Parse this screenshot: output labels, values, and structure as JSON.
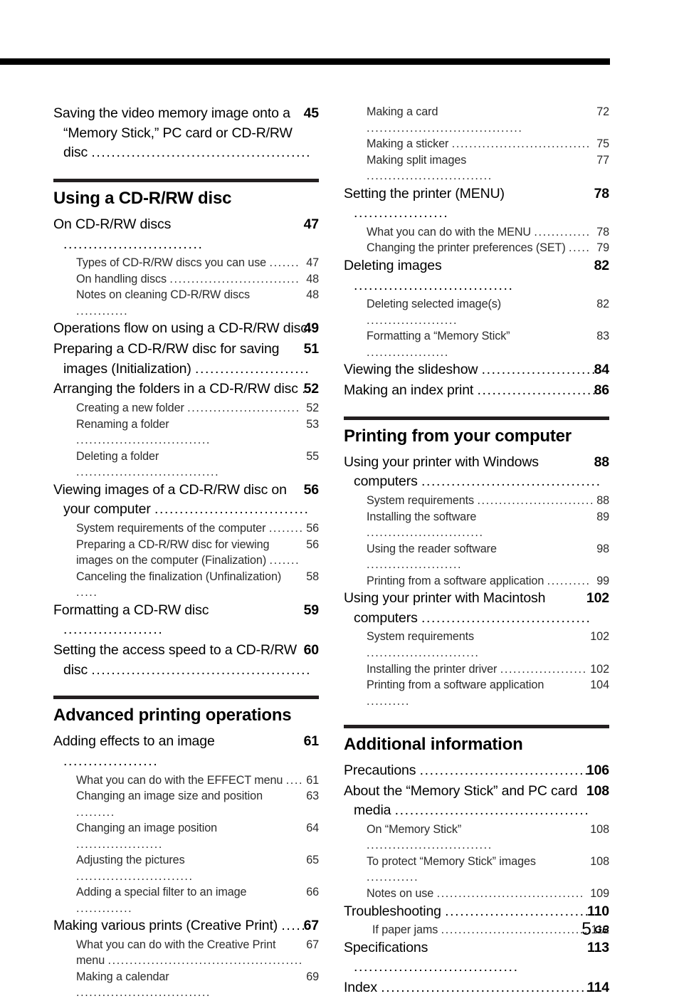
{
  "page": {
    "folio_number": "5",
    "folio_suffix": "GB"
  },
  "columns": {
    "left": [
      {
        "type": "orphan_entries",
        "entries": [
          {
            "level": "major",
            "text": "Saving the video memory image onto a “Memory Stick,” PC card or CD-R/RW disc",
            "page": "45"
          }
        ]
      },
      {
        "type": "section",
        "title": "Using a CD-R/RW disc",
        "entries": [
          {
            "level": "major",
            "text": "On CD-R/RW discs",
            "page": "47"
          },
          {
            "level": "sub",
            "text": "Types of CD-R/RW discs you can use",
            "page": "47"
          },
          {
            "level": "sub",
            "text": "On handling discs",
            "page": "48"
          },
          {
            "level": "sub",
            "text": "Notes on cleaning CD-R/RW discs",
            "page": "48"
          },
          {
            "level": "major",
            "text": "Operations flow on using a CD-R/RW disc",
            "page": "49"
          },
          {
            "level": "major",
            "text": "Preparing a CD-R/RW disc for saving images (Initialization)",
            "page": "51"
          },
          {
            "level": "major",
            "text": "Arranging the folders in a CD-R/RW disc",
            "page": "52"
          },
          {
            "level": "sub",
            "text": "Creating a new folder",
            "page": "52"
          },
          {
            "level": "sub",
            "text": "Renaming a folder",
            "page": "53"
          },
          {
            "level": "sub",
            "text": "Deleting a folder",
            "page": "55"
          },
          {
            "level": "major",
            "text": "Viewing images of a CD-R/RW disc on your computer",
            "page": "56"
          },
          {
            "level": "sub",
            "text": "System requirements of the computer",
            "page": "56"
          },
          {
            "level": "sub",
            "text": "Preparing a CD-R/RW disc for viewing images on the computer (Finalization)",
            "page": "56"
          },
          {
            "level": "sub",
            "text": "Canceling the finalization (Unfinalization)",
            "page": "58"
          },
          {
            "level": "major",
            "text": "Formatting a CD-RW disc",
            "page": "59"
          },
          {
            "level": "major",
            "text": "Setting the access speed to a CD-R/RW disc",
            "page": "60"
          }
        ]
      },
      {
        "type": "section",
        "title": "Advanced printing operations",
        "entries": [
          {
            "level": "major",
            "text": "Adding effects to an image",
            "page": "61"
          },
          {
            "level": "sub",
            "text": "What you can do with the EFFECT menu",
            "page": "61"
          },
          {
            "level": "sub",
            "text": "Changing an image size and position",
            "page": "63"
          },
          {
            "level": "sub",
            "text": "Changing an image position",
            "page": "64"
          },
          {
            "level": "sub",
            "text": "Adjusting the pictures",
            "page": "65"
          },
          {
            "level": "sub",
            "text": "Adding a special filter to an image",
            "page": "66"
          },
          {
            "level": "major",
            "text": "Making various prints (Creative Print)",
            "page": "67"
          },
          {
            "level": "sub",
            "text": "What you can do with the Creative Print menu",
            "page": "67"
          },
          {
            "level": "sub",
            "text": "Making a calendar",
            "page": "69"
          }
        ]
      }
    ],
    "right": [
      {
        "type": "orphan_entries",
        "entries": [
          {
            "level": "sub",
            "text": "Making a card",
            "page": "72"
          },
          {
            "level": "sub",
            "text": "Making a sticker",
            "page": "75"
          },
          {
            "level": "sub",
            "text": "Making split images",
            "page": "77"
          },
          {
            "level": "major",
            "text": "Setting the printer (MENU)",
            "page": "78"
          },
          {
            "level": "sub",
            "text": "What you can do with the MENU",
            "page": "78"
          },
          {
            "level": "sub",
            "text": "Changing the printer preferences (SET)",
            "page": "79"
          },
          {
            "level": "major",
            "text": "Deleting images",
            "page": "82"
          },
          {
            "level": "sub",
            "text": "Deleting selected image(s)",
            "page": "82"
          },
          {
            "level": "sub",
            "text": "Formatting a “Memory Stick”",
            "page": "83"
          },
          {
            "level": "major",
            "text": "Viewing the slideshow",
            "page": "84"
          },
          {
            "level": "major",
            "text": "Making an index print",
            "page": "86"
          }
        ]
      },
      {
        "type": "section",
        "title": "Printing from your computer",
        "entries": [
          {
            "level": "major",
            "text": "Using your printer with Windows computers",
            "page": "88"
          },
          {
            "level": "sub",
            "text": "System requirements",
            "page": "88"
          },
          {
            "level": "sub",
            "text": "Installing the software",
            "page": "89"
          },
          {
            "level": "sub",
            "text": "Using the reader software",
            "page": "98"
          },
          {
            "level": "sub",
            "text": "Printing from a software application",
            "page": "99"
          },
          {
            "level": "major",
            "text": "Using your printer with Macintosh computers",
            "page": "102"
          },
          {
            "level": "sub",
            "text": "System requirements",
            "page": "102"
          },
          {
            "level": "sub",
            "text": "Installing the printer driver",
            "page": "102"
          },
          {
            "level": "sub",
            "text": "Printing from a software application",
            "page": "104"
          }
        ]
      },
      {
        "type": "section",
        "title": "Additional information",
        "entries": [
          {
            "level": "major",
            "text": "Precautions",
            "page": "106"
          },
          {
            "level": "major",
            "text": "About the “Memory Stick” and PC card media",
            "page": "108"
          },
          {
            "level": "sub",
            "text": "On “Memory Stick”",
            "page": "108"
          },
          {
            "level": "sub",
            "text": "To protect “Memory Stick” images",
            "page": "108"
          },
          {
            "level": "sub",
            "text": "Notes on use",
            "page": "109"
          },
          {
            "level": "major",
            "text": "Troubleshooting",
            "page": "110"
          },
          {
            "level": "sub",
            "text": "If paper jams",
            "page": "112",
            "extra_indent": true
          },
          {
            "level": "major",
            "text": "Specifications",
            "page": "113"
          },
          {
            "level": "major",
            "text": "Index",
            "page": "114"
          }
        ]
      }
    ]
  }
}
